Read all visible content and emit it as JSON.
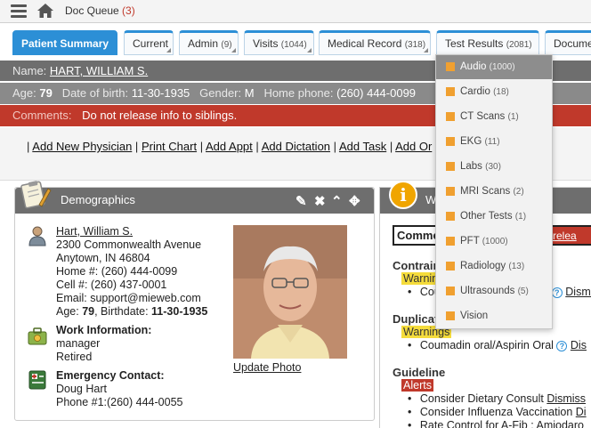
{
  "topbar": {
    "doc_queue_label": "Doc Queue",
    "doc_queue_count": "(3)"
  },
  "tabs": [
    {
      "label": "Patient Summary",
      "count": ""
    },
    {
      "label": "Current",
      "count": ""
    },
    {
      "label": "Admin",
      "count": "(9)"
    },
    {
      "label": "Visits",
      "count": "(1044)"
    },
    {
      "label": "Medical Record",
      "count": "(318)"
    },
    {
      "label": "Test Results",
      "count": "(2081)"
    },
    {
      "label": "Docume",
      "count": ""
    }
  ],
  "patient": {
    "name_label": "Name:",
    "name": "HART, WILLIAM S.",
    "age_label": "Age:",
    "age": "79",
    "dob_label": "Date of birth:",
    "dob": "11-30-1935",
    "gender_label": "Gender:",
    "gender": "M",
    "phone_label": "Home phone:",
    "phone": "(260) 444-0099",
    "comments_label": "Comments:",
    "comments": "Do not release info to siblings."
  },
  "links": {
    "sep": "|",
    "items": [
      "Add New Physician",
      "Print Chart",
      "Add Appt",
      "Add Dictation",
      "Add Task",
      "Add Or"
    ]
  },
  "demographics": {
    "title": "Demographics",
    "name": "Hart, William S.",
    "address1": "2300 Commonwealth Avenue",
    "address2": "Anytown, IN 46804",
    "home": "Home #: (260) 444-0099",
    "cell": "Cell #: (260) 437-0001",
    "email": "Email: support@mieweb.com",
    "age_line_prefix": "Age:",
    "age": "79",
    "birthdate_prefix": ", Birthdate:",
    "birthdate": "11-30-1935",
    "work_title": "Work Information:",
    "work_role": "manager",
    "work_status": "Retired",
    "emergency_title": "Emergency Contact:",
    "emergency_name": "Doug Hart",
    "emergency_phone": "Phone #1:(260) 444-0055",
    "update_photo": "Update Photo"
  },
  "warnings": {
    "title_partial": "W",
    "comments_label": "Comme",
    "dnr_partial": "not relea",
    "contraindications": "Contrain",
    "contra_tag": "Warnin",
    "contra_item": "Cou",
    "contra_item_link": "Dismis",
    "duplicates": "Duplicat",
    "dup_tag": "Warnings",
    "dup_item": "Coumadin oral/Aspirin Oral",
    "dup_link": "Dis",
    "guideline": "Guideline",
    "guide_tag": "Alerts",
    "guide_item1": "Consider Dietary Consult",
    "guide_link1": "Dismiss",
    "guide_item2": "Consider Influenza Vaccination",
    "guide_link2": "Di",
    "guide_item3": "Rate Control for A-Fib : Amiodaro"
  },
  "dropdown": {
    "items": [
      {
        "label": "Audio",
        "count": "(1000)"
      },
      {
        "label": "Cardio",
        "count": "(18)"
      },
      {
        "label": "CT Scans",
        "count": "(1)"
      },
      {
        "label": "EKG",
        "count": "(11)"
      },
      {
        "label": "Labs",
        "count": "(30)"
      },
      {
        "label": "MRI Scans",
        "count": "(2)"
      },
      {
        "label": "Other Tests",
        "count": "(1)"
      },
      {
        "label": "PFT",
        "count": "(1000)"
      },
      {
        "label": "Radiology",
        "count": "(13)"
      },
      {
        "label": "Ultrasounds",
        "count": "(5)"
      },
      {
        "label": "Vision",
        "count": ""
      }
    ]
  },
  "colors": {
    "accent": "#2c8fd6",
    "alert": "#c0392b",
    "warning": "#f5dc3c",
    "header_gray": "#6e6e6e"
  }
}
